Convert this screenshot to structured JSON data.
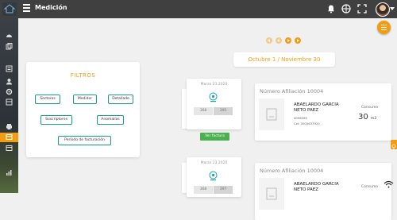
{
  "header": {
    "title": "Medición"
  },
  "period": "Octubre 1 / Noviembre 30",
  "filters": {
    "title": "FILTROS",
    "buttons": {
      "sectores": "Sectores",
      "medidor": "Medidor",
      "detallado": "Detallado",
      "suscriptores": "Suscriptores",
      "anomalias": "Anomalías",
      "periodo": "Período de facturación"
    }
  },
  "readings": [
    {
      "date": "Marzo 23 2020",
      "previous": "368",
      "current": "395",
      "button": "Ver factura"
    },
    {
      "date": "Marzo 23 2020",
      "previous": "368",
      "current": "397"
    }
  ],
  "affiliations": [
    {
      "title": "Número Afiliación 10004",
      "name": "ABAELARDO GARCIA NETO PAEZ",
      "id": "4096065",
      "phone": "Cel: 3005637920",
      "consumo_label": "Consumo",
      "consumo_value": "30",
      "consumo_unit": "m3"
    },
    {
      "title": "Número Afiliación 10004",
      "name": "ABAELARDO GARCIA NETO PAEZ",
      "consumo_label": "Consumo"
    }
  ],
  "colors": {
    "accent": "#f39c12",
    "topbar": "#404040",
    "filter_border": "#16a085",
    "button_green": "#4caf50"
  }
}
